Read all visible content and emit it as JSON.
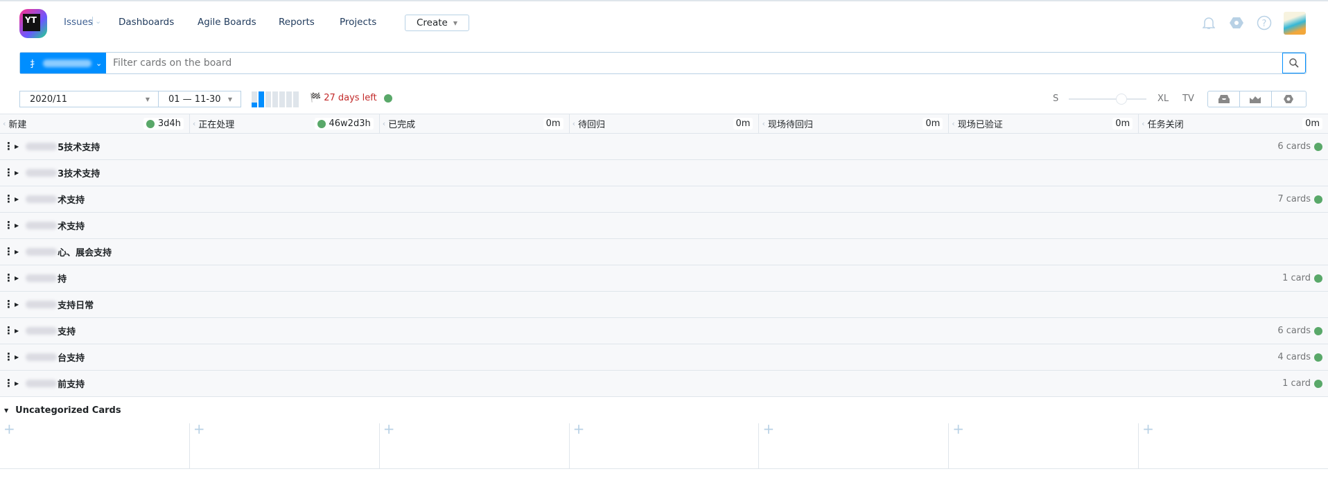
{
  "header": {
    "logo_text": "YT",
    "nav": [
      {
        "label": "Issues"
      },
      {
        "label": "Dashboards"
      },
      {
        "label": "Agile Boards"
      },
      {
        "label": "Reports"
      },
      {
        "label": "Projects"
      }
    ],
    "create_label": "Create",
    "icons": [
      "bell-icon",
      "settings-icon",
      "help-icon",
      "avatar"
    ]
  },
  "filter": {
    "project_label": "扌",
    "placeholder": "Filter cards on the board"
  },
  "sprint": {
    "name": "2020/11",
    "range": "01 — 11-30",
    "days_left": "27 days left",
    "progress_segments": 7,
    "progress_current": 2
  },
  "size": {
    "small": "S",
    "large": "XL",
    "tv": "TV",
    "slider_value": 0.68
  },
  "columns": [
    {
      "name": "新建",
      "time": "3d4h",
      "dot": true
    },
    {
      "name": "正在处理",
      "time": "46w2d3h",
      "dot": true
    },
    {
      "name": "已完成",
      "time": "0m"
    },
    {
      "name": "待回归",
      "time": "0m"
    },
    {
      "name": "现场待回归",
      "time": "0m"
    },
    {
      "name": "现场已验证",
      "time": "0m"
    },
    {
      "name": "任务关闭",
      "time": "0m"
    }
  ],
  "swimlanes": [
    {
      "label": "5技术支持",
      "count": "6 cards"
    },
    {
      "label": "3技术支持",
      "count": ""
    },
    {
      "label": "术支持",
      "count": "7 cards"
    },
    {
      "label": "术支持",
      "count": ""
    },
    {
      "label": "心、展会支持",
      "count": ""
    },
    {
      "label": "持",
      "count": "1 card"
    },
    {
      "label": "支持日常",
      "count": ""
    },
    {
      "label": "支持",
      "count": "6 cards"
    },
    {
      "label": "台支持",
      "count": "4 cards"
    },
    {
      "label": "前支持",
      "count": "1 card"
    }
  ],
  "uncategorized": {
    "title": "Uncategorized Cards",
    "add": "+"
  },
  "colors": {
    "accent": "#008eff",
    "green": "#59a869",
    "flag": "#c22a2a"
  }
}
